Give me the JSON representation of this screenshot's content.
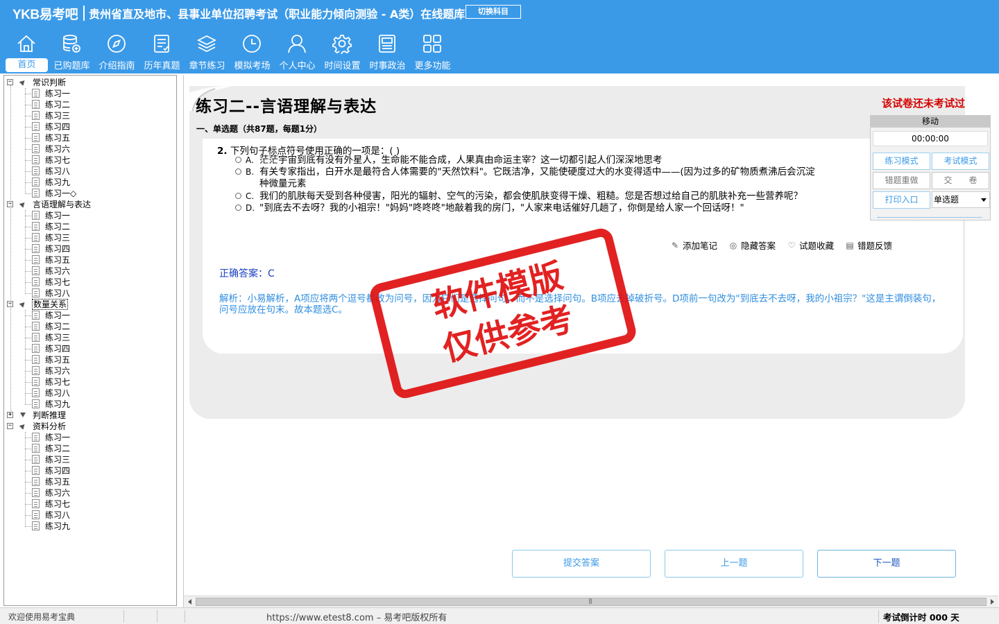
{
  "window": {
    "logo": "YKB易考吧",
    "title": "贵州省直及地市、县事业单位招聘考试（职业能力倾向测验 - A类）在线题库",
    "switch_subject": "切换科目"
  },
  "nav": [
    {
      "label": "首页",
      "icon": "home-icon"
    },
    {
      "label": "已购题库",
      "icon": "database-icon"
    },
    {
      "label": "介绍指南",
      "icon": "compass-icon"
    },
    {
      "label": "历年真题",
      "icon": "exam-paper-icon"
    },
    {
      "label": "章节练习",
      "icon": "layers-icon"
    },
    {
      "label": "模拟考场",
      "icon": "clock-icon"
    },
    {
      "label": "个人中心",
      "icon": "user-icon"
    },
    {
      "label": "时间设置",
      "icon": "gear-icon"
    },
    {
      "label": "时事政治",
      "icon": "news-icon"
    },
    {
      "label": "更多功能",
      "icon": "grid-icon"
    }
  ],
  "tree": [
    {
      "label": "常识判断",
      "expanded": true,
      "items": [
        "练习一",
        "练习二",
        "练习三",
        "练习四",
        "练习五",
        "练习六",
        "练习七",
        "练习八",
        "练习九",
        "练习一◇"
      ]
    },
    {
      "label": "言语理解与表达",
      "expanded": true,
      "items": [
        "练习一",
        "练习二",
        "练习三",
        "练习四",
        "练习五",
        "练习六",
        "练习七",
        "练习八"
      ]
    },
    {
      "label": "数量关系",
      "expanded": true,
      "selected": true,
      "items": [
        "练习一",
        "练习二",
        "练习三",
        "练习四",
        "练习五",
        "练习六",
        "练习七",
        "练习八",
        "练习九"
      ]
    },
    {
      "label": "判断推理",
      "expanded": false,
      "items": []
    },
    {
      "label": "资料分析",
      "expanded": true,
      "items": [
        "练习一",
        "练习二",
        "练习三",
        "练习四",
        "练习五",
        "练习六",
        "练习七",
        "练习八",
        "练习九"
      ]
    }
  ],
  "exam": {
    "title": "练习二--言语理解与表达",
    "status": "该试卷还未考试过",
    "section": "一、单选题（共87题，每题1分）",
    "question_no": "2.",
    "question": "下列句子标点符号使用正确的一项是：( )",
    "options": [
      {
        "letter": "A.",
        "text": "茫茫宇宙到底有没有外星人，生命能不能合成，人果真由命运主宰？这一切都引起人们深深地思考"
      },
      {
        "letter": "B.",
        "text": "有关专家指出，白开水是最符合人体需要的\"天然饮料\"。它既洁净，又能使硬度过大的水变得适中——(因为过多的矿物质煮沸后会沉淀",
        "text2": "种微量元素"
      },
      {
        "letter": "C.",
        "text": "我们的肌肤每天受到各种侵害，阳光的辐射、空气的污染，都会使肌肤变得干燥、粗糙。您是否想过给自己的肌肤补充一些营养呢？"
      },
      {
        "letter": "D.",
        "text": "\"到底去不去呀？我的小祖宗！\"妈妈\"咚咚咚\"地敲着我的房门，\"人家来电话催好几趟了，你倒是给人家一个回话呀！\""
      }
    ],
    "tools": [
      "添加笔记",
      "隐藏答案",
      "试题收藏",
      "错题反馈"
    ],
    "answer": "正确答案：C",
    "analysis": "解析：小易解析，A项应将两个逗号都改为问号，因为它们是选择问句，而不是选择问句。B项应去掉破折号。D项前一句改为\"到底去不去呀，我的小祖宗？\"这是主谓倒装句，问号应放在句末。故本题选C。"
  },
  "watermark": [
    "软件模版",
    "仅供参考"
  ],
  "panel": {
    "move": "移动",
    "timer": "00:00:00",
    "practice_mode": "练习模式",
    "exam_mode": "考试模式",
    "redo_wrong": "错题重做",
    "submit_paper": "交　　卷",
    "print": "打印入口",
    "type_select": "单选题"
  },
  "buttons": {
    "submit": "提交答案",
    "prev": "上一题",
    "next": "下一题"
  },
  "status": {
    "welcome": "欢迎使用易考宝典",
    "copyright": "https://www.etest8.com – 易考吧版权所有",
    "countdown": "考试倒计时 000 天"
  }
}
